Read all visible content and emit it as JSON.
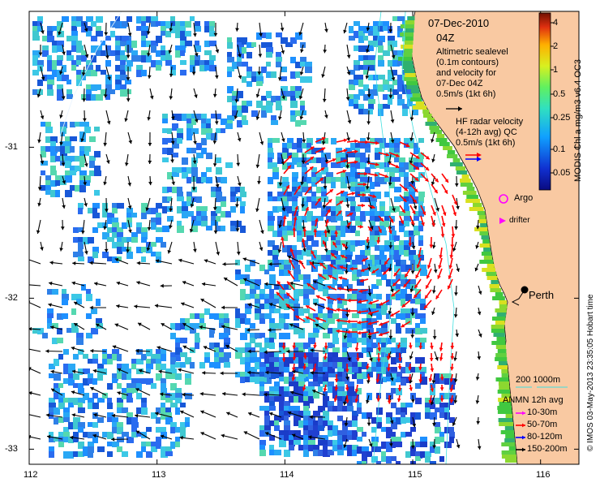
{
  "title": {
    "date": "07-Dec-2010",
    "time": "04Z",
    "altimetry_lines": [
      "Altimetric sealevel",
      "(0.1m contours)",
      "and velocity for",
      "07-Dec 04Z",
      "0.5m/s (1kt 6h)"
    ],
    "hf_lines": [
      "HF radar velocity",
      "(4-12h avg) QC",
      "0.5m/s (1kt 6h)"
    ]
  },
  "legend": {
    "argo": "Argo",
    "drifter": "drifter",
    "scale_label": "200  1000m",
    "anmn_title": "ANMN 12h avg",
    "anmn_items": [
      {
        "label": "10-30m",
        "color": "#ff00ff"
      },
      {
        "label": "50-70m",
        "color": "#ff0000"
      },
      {
        "label": "80-120m",
        "color": "#0000ff"
      },
      {
        "label": "150-200m",
        "color": "#000000"
      }
    ]
  },
  "colorbar": {
    "title": "MODIS Chl a mg/m3 v6.4 OC3",
    "ticks": [
      "4",
      "2",
      "1",
      "0.5",
      "0.25",
      "0.1",
      "0.05"
    ]
  },
  "city": {
    "name": "Perth"
  },
  "credit": "© IMOS 03-May-2013 23:35:05 Hobart time",
  "axes": {
    "x_ticks": [
      "112",
      "113",
      "114",
      "115",
      "116"
    ],
    "y_ticks": [
      "-31",
      "-32",
      "-33"
    ],
    "lon_range": [
      112,
      116.3
    ],
    "lat_range": [
      -33.1,
      -30.1
    ]
  },
  "colors": {
    "land": "#f9c9a2",
    "hf_arrow": "#ff0000",
    "alt_arrow": "#000000",
    "argo": "#ff00ff",
    "contour": "#40e0e0"
  },
  "icons": {
    "city_marker": "filled-circle",
    "argo_marker": "open-circle",
    "drifter_marker": "triangle"
  }
}
